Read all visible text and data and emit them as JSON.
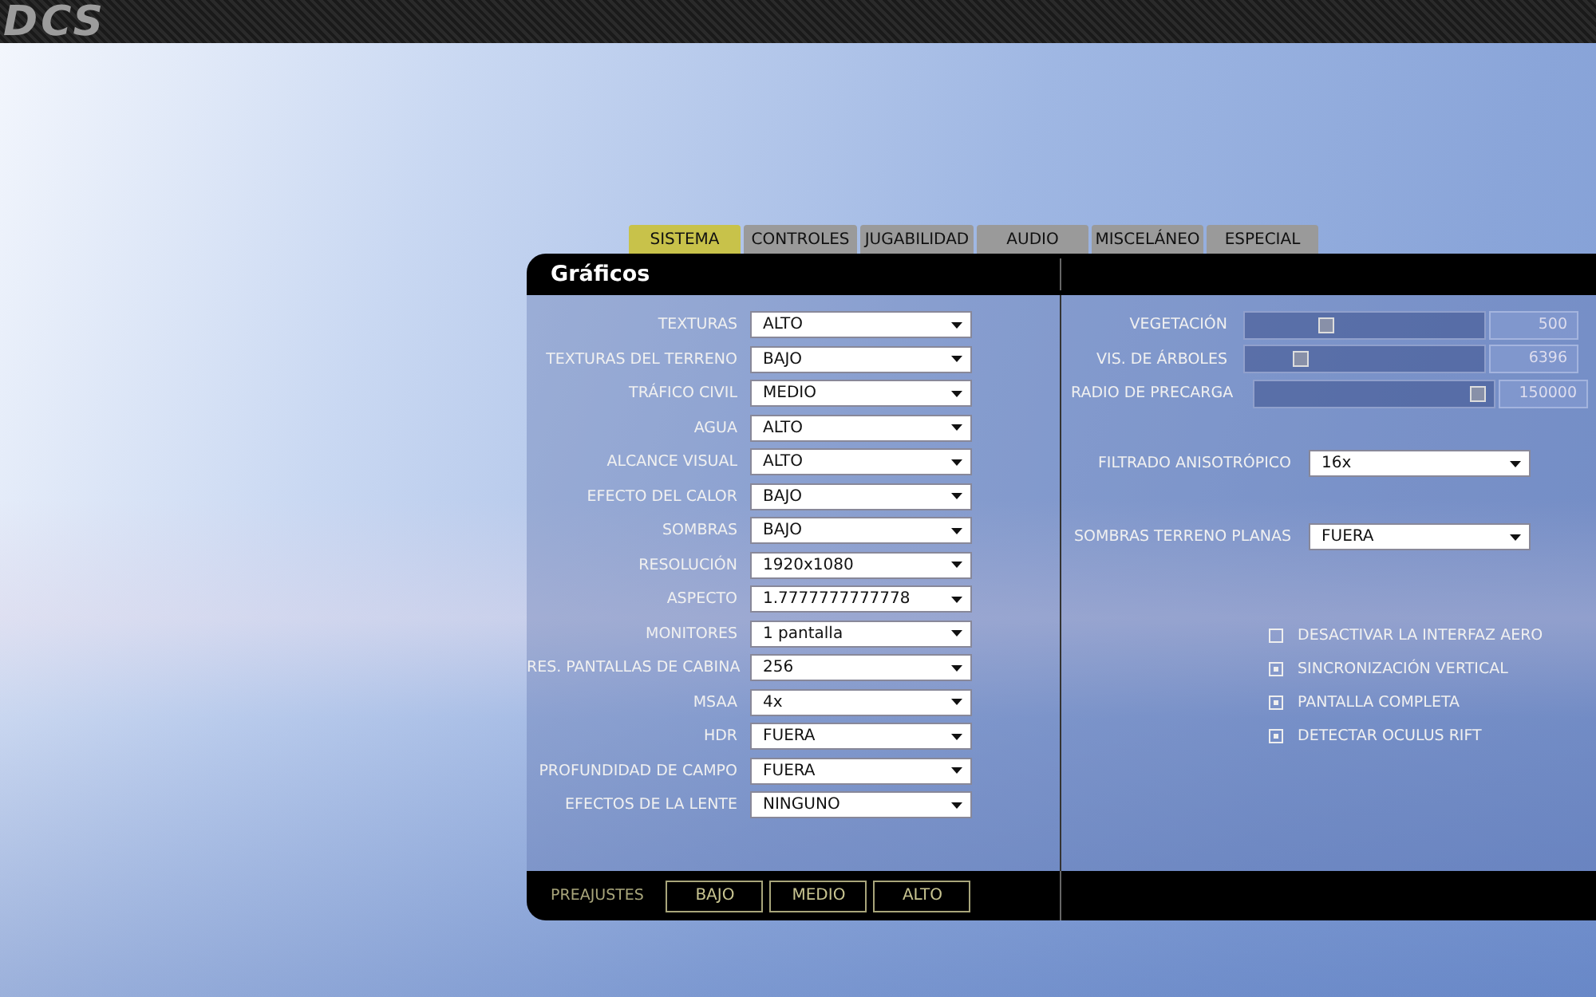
{
  "logo": "DCS",
  "tabs": [
    {
      "label": "SISTEMA",
      "selected": true
    },
    {
      "label": "CONTROLES",
      "selected": false
    },
    {
      "label": "JUGABILIDAD",
      "selected": false
    },
    {
      "label": "AUDIO",
      "selected": false
    },
    {
      "label": "MISCELÁNEO",
      "selected": false
    },
    {
      "label": "ESPECIAL",
      "selected": false
    }
  ],
  "panel_title": "Gráficos",
  "settings": [
    {
      "label": "TEXTURAS",
      "value": "ALTO"
    },
    {
      "label": "TEXTURAS DEL TERRENO",
      "value": "BAJO"
    },
    {
      "label": "TRÁFICO CIVIL",
      "value": "MEDIO"
    },
    {
      "label": "AGUA",
      "value": "ALTO"
    },
    {
      "label": "ALCANCE VISUAL",
      "value": "ALTO"
    },
    {
      "label": "EFECTO DEL CALOR",
      "value": "BAJO"
    },
    {
      "label": "SOMBRAS",
      "value": "BAJO"
    },
    {
      "label": "RESOLUCIÓN",
      "value": "1920x1080"
    },
    {
      "label": "ASPECTO",
      "value": "1.7777777777778"
    },
    {
      "label": "MONITORES",
      "value": "1 pantalla"
    },
    {
      "label": "RES. PANTALLAS DE CABINA",
      "value": "256"
    },
    {
      "label": "MSAA",
      "value": "4x"
    },
    {
      "label": "HDR",
      "value": "FUERA"
    },
    {
      "label": "PROFUNDIDAD DE CAMPO",
      "value": "FUERA"
    },
    {
      "label": "EFECTOS DE LA LENTE",
      "value": "NINGUNO"
    }
  ],
  "sliders": [
    {
      "label": "VEGETACIÓN",
      "level": 0.34,
      "reading": "500"
    },
    {
      "label": "VIS. DE ÁRBOLES",
      "level": 0.23,
      "reading": "6396"
    },
    {
      "label": "RADIO DE PRECARGA",
      "level": 0.93,
      "reading": "150000"
    }
  ],
  "right_settings": [
    {
      "label": "FILTRADO ANISOTRÓPICO",
      "value": "16x"
    },
    {
      "label": "SOMBRAS TERRENO PLANAS",
      "value": "FUERA"
    }
  ],
  "checkboxes": [
    {
      "label": "DESACTIVAR LA INTERFAZ AERO",
      "checked": false
    },
    {
      "label": "SINCRONIZACIÓN VERTICAL",
      "checked": true
    },
    {
      "label": "PANTALLA COMPLETA",
      "checked": true
    },
    {
      "label": "DETECTAR OCULUS RIFT",
      "checked": true
    }
  ],
  "presets": {
    "label": "PREAJUSTES",
    "buttons": [
      "BAJO",
      "MEDIO",
      "ALTO"
    ]
  }
}
